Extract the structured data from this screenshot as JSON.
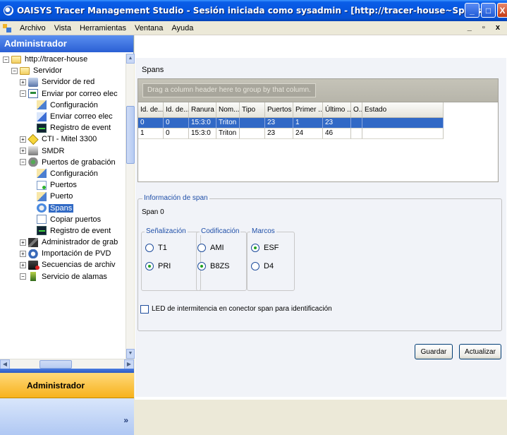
{
  "window": {
    "title": "OAISYS Tracer Management Studio - Sesión iniciada como sysadmin - [http://tracer-house~Spans]",
    "mdi_controls": "_ ▫ x"
  },
  "menu": {
    "items": [
      "Archivo",
      "Vista",
      "Herramientas",
      "Ventana",
      "Ayuda"
    ]
  },
  "left": {
    "header": "Administrador",
    "nav_label": "Administrador",
    "chevron": "»",
    "tree": [
      {
        "label": "http://tracer-house",
        "icon": "folder-icon",
        "expander": "−"
      },
      {
        "label": "Servidor",
        "icon": "folder-icon",
        "expander": "−"
      },
      {
        "label": "Servidor de red",
        "icon": "network-server-icon",
        "expander": "+"
      },
      {
        "label": "Enviar por correo elec",
        "icon": "email-icon",
        "expander": "−"
      },
      {
        "label": "Configuración",
        "icon": "configuration-icon",
        "expander": ""
      },
      {
        "label": "Enviar correo elec",
        "icon": "send-email-icon",
        "expander": ""
      },
      {
        "label": "Registro de event",
        "icon": "event-log-icon",
        "expander": ""
      },
      {
        "label": "CTI - Mitel 3300",
        "icon": "cti-icon",
        "expander": "+"
      },
      {
        "label": "SMDR",
        "icon": "smdr-icon",
        "expander": "+"
      },
      {
        "label": "Puertos de grabación",
        "icon": "recording-ports-icon",
        "expander": "−"
      },
      {
        "label": "Configuración",
        "icon": "configuration-icon",
        "expander": ""
      },
      {
        "label": "Puertos",
        "icon": "ports-icon",
        "expander": ""
      },
      {
        "label": "Puerto",
        "icon": "port-icon",
        "expander": ""
      },
      {
        "label": "Spans",
        "icon": "spans-icon",
        "expander": "",
        "selected": true
      },
      {
        "label": "Copiar puertos",
        "icon": "copy-ports-icon",
        "expander": ""
      },
      {
        "label": "Registro de event",
        "icon": "event-log-icon",
        "expander": ""
      },
      {
        "label": "Administrador de grab",
        "icon": "recording-admin-icon",
        "expander": "+"
      },
      {
        "label": "Importación de PVD",
        "icon": "pvd-import-icon",
        "expander": "+"
      },
      {
        "label": "Secuencias de archiv",
        "icon": "archive-sequences-icon",
        "expander": "+"
      },
      {
        "label": "Servicio de alamas",
        "icon": "alarm-service-icon",
        "expander": "−"
      }
    ]
  },
  "spans": {
    "title": "Spans",
    "group_hint": "Drag a column header here to group by that column.",
    "columns": [
      "Id. de...",
      "Id. de...",
      "Ranura ...",
      "Nom...",
      "Tipo",
      "Puertos",
      "Primer ...",
      "Último ...",
      "O...",
      "Estado"
    ],
    "rows": [
      [
        "0",
        "0",
        "15:3:0",
        "Triton",
        "",
        "23",
        "1",
        "23",
        "",
        ""
      ],
      [
        "1",
        "0",
        "15:3:0",
        "Triton",
        "",
        "23",
        "24",
        "46",
        "",
        ""
      ]
    ],
    "selected_row": 0
  },
  "info": {
    "legend": "Información de span",
    "span_name": "Span 0",
    "signaling": {
      "legend": "Señalización",
      "options": [
        "T1",
        "PRI"
      ],
      "selected": "PRI"
    },
    "coding": {
      "legend": "Codificación",
      "options": [
        "AMI",
        "B8ZS"
      ],
      "selected": "B8ZS"
    },
    "framing": {
      "legend": "Marcos",
      "options": [
        "ESF",
        "D4"
      ],
      "selected": "ESF"
    },
    "led_checkbox": {
      "label": "LED de intermitencia en conector span para identificación",
      "checked": false
    }
  },
  "buttons": {
    "save": "Guardar",
    "refresh": "Actualizar"
  }
}
